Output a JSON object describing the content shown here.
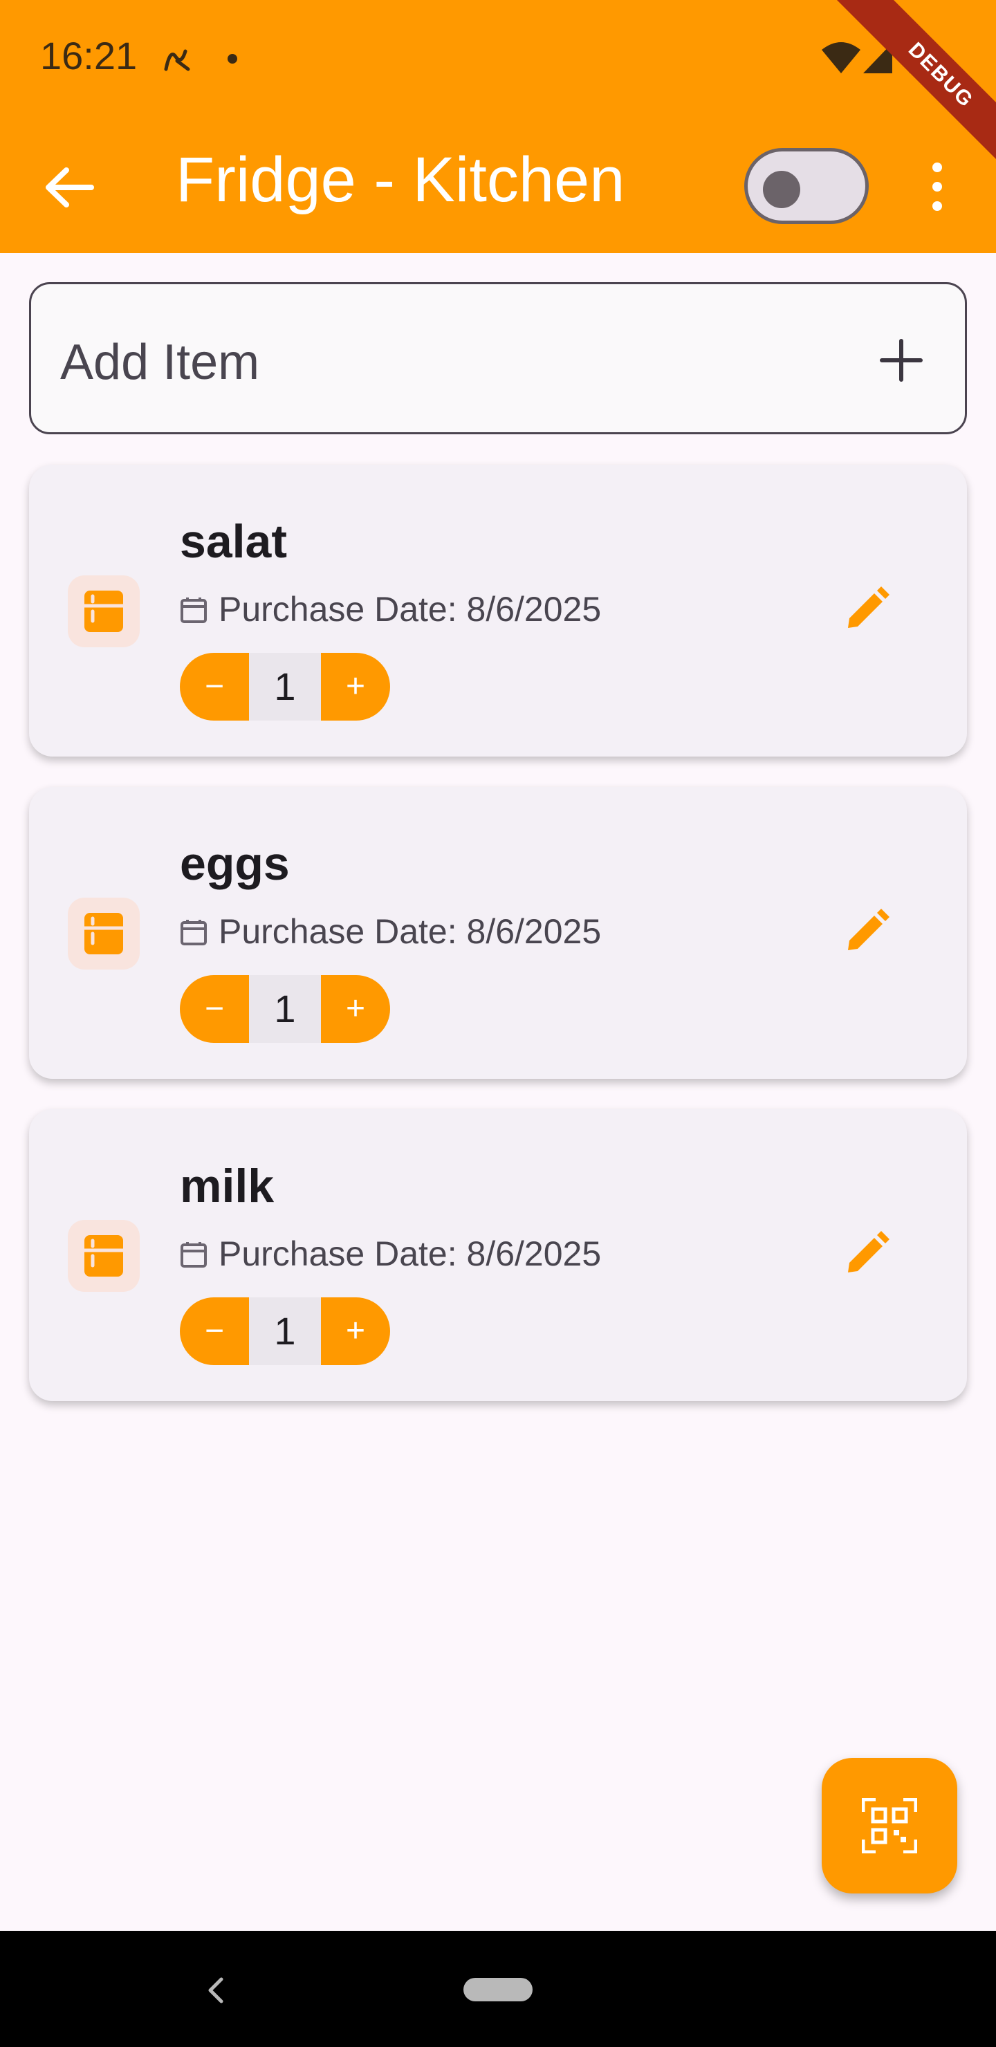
{
  "status_bar": {
    "time": "16:21",
    "debug_label": "DEBUG"
  },
  "app_bar": {
    "title": "Fridge - Kitchen",
    "toggle_on": false
  },
  "add_item": {
    "label": "Add Item"
  },
  "items": [
    {
      "name": "salat",
      "date": "Purchase Date: 8/6/2025",
      "quantity": "1"
    },
    {
      "name": "eggs",
      "date": "Purchase Date: 8/6/2025",
      "quantity": "1"
    },
    {
      "name": "milk",
      "date": "Purchase Date: 8/6/2025",
      "quantity": "1"
    }
  ],
  "colors": {
    "accent": "#FF9900",
    "background": "#FDF7FC",
    "card": "#F4F0F6"
  },
  "icons": {
    "back": "arrow-left-icon",
    "menu": "more-vert-icon",
    "add": "plus-icon",
    "item": "fridge-icon",
    "date": "calendar-icon",
    "edit": "pencil-icon",
    "fab": "qr-scanner-icon"
  }
}
